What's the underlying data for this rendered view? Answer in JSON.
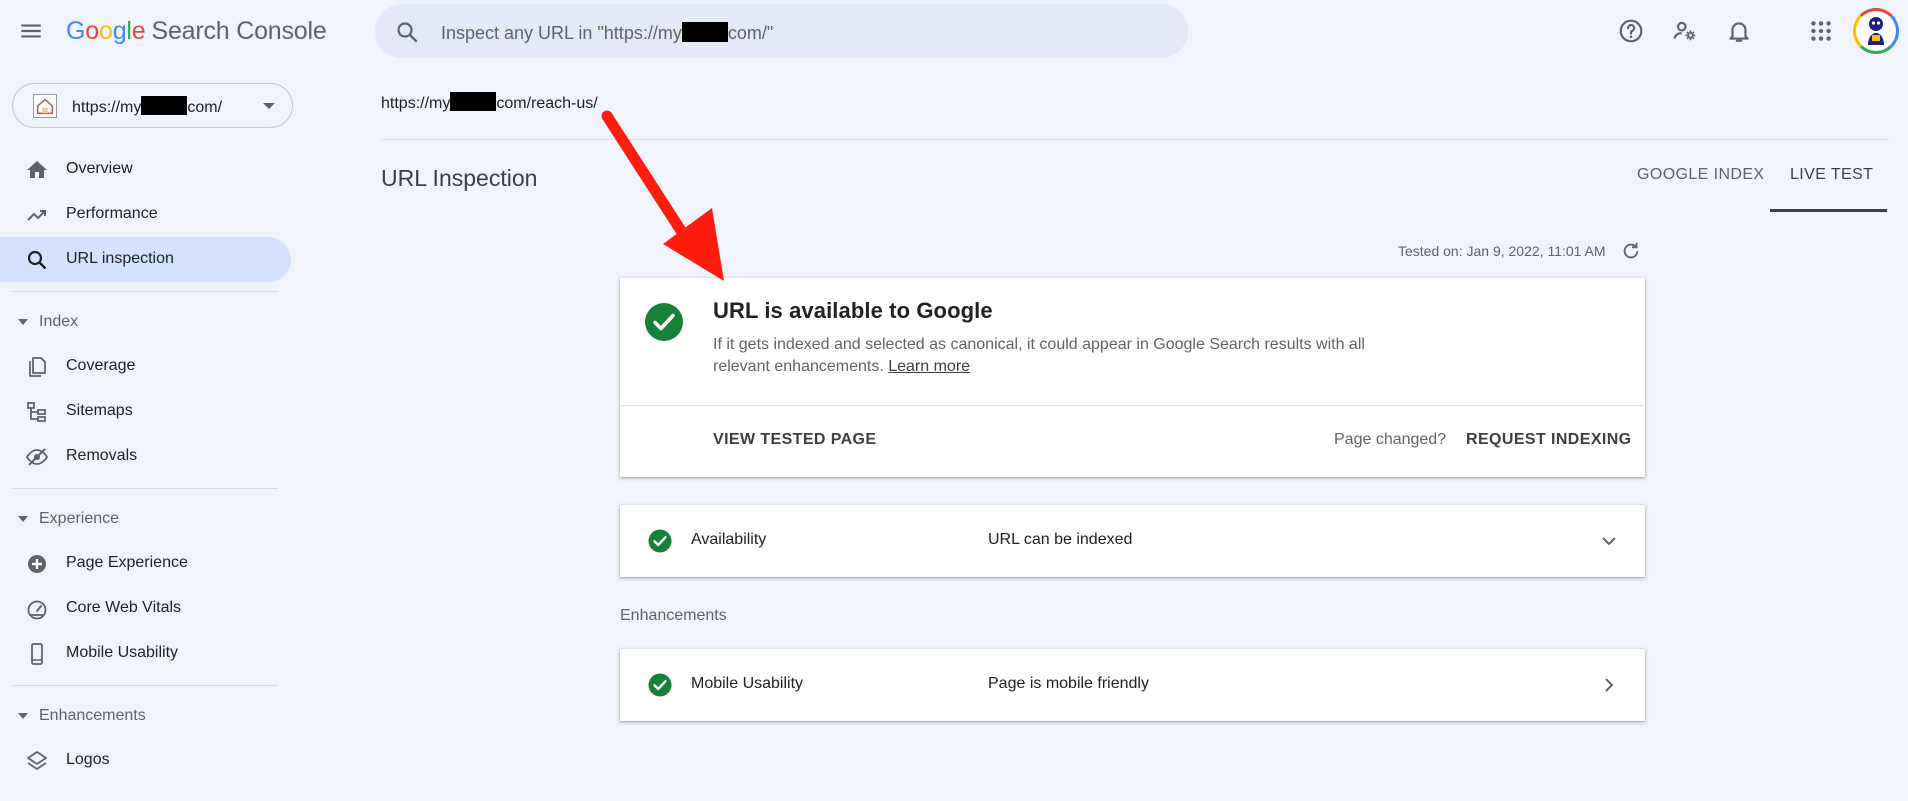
{
  "app": {
    "logo_letters": [
      "G",
      "o",
      "o",
      "g",
      "l",
      "e"
    ],
    "product_name": "Search Console"
  },
  "search": {
    "text_before": "Inspect any URL in \"https://my",
    "text_after": "com/\""
  },
  "header_icons": [
    "help-icon",
    "manage-users-icon",
    "notifications-icon",
    "apps-grid-icon",
    "account-avatar"
  ],
  "property": {
    "prefix": "https://my",
    "suffix": "com/"
  },
  "sidebar": {
    "top_items": [
      {
        "label": "Overview",
        "icon": "home-icon"
      },
      {
        "label": "Performance",
        "icon": "trending-up-icon"
      },
      {
        "label": "URL inspection",
        "icon": "search-icon",
        "active": true
      }
    ],
    "sections": [
      {
        "label": "Index",
        "items": [
          {
            "label": "Coverage",
            "icon": "coverage-icon"
          },
          {
            "label": "Sitemaps",
            "icon": "sitemaps-icon"
          },
          {
            "label": "Removals",
            "icon": "removals-icon"
          }
        ]
      },
      {
        "label": "Experience",
        "items": [
          {
            "label": "Page Experience",
            "icon": "page-experience-icon"
          },
          {
            "label": "Core Web Vitals",
            "icon": "speedometer-icon"
          },
          {
            "label": "Mobile Usability",
            "icon": "smartphone-icon"
          }
        ]
      },
      {
        "label": "Enhancements",
        "items": [
          {
            "label": "Logos",
            "icon": "layers-icon"
          }
        ]
      }
    ]
  },
  "main": {
    "url_prefix": "https://my",
    "url_suffix": "com/reach-us/",
    "title": "URL Inspection",
    "tabs": [
      {
        "label": "GOOGLE INDEX",
        "active": false
      },
      {
        "label": "LIVE TEST",
        "active": true
      }
    ],
    "tested_on": "Tested on: Jan 9, 2022, 11:01 AM",
    "status_card": {
      "title": "URL is available to Google",
      "description": "If it gets indexed and selected as canonical, it could appear in Google Search results with all relevant enhancements.",
      "learn_more": "Learn more",
      "view_tested_page": "VIEW TESTED PAGE",
      "page_changed": "Page changed?",
      "request_indexing": "REQUEST INDEXING"
    },
    "availability": {
      "label": "Availability",
      "value": "URL can be indexed"
    },
    "enhancements_heading": "Enhancements",
    "mobile_usability": {
      "label": "Mobile Usability",
      "value": "Page is mobile friendly"
    }
  },
  "colors": {
    "background": "#f1f4fc",
    "search_bg": "#e3e9f7",
    "active_nav": "#d3e3fd",
    "success_green": "#188038",
    "annotation_red": "#ff1d0e"
  }
}
